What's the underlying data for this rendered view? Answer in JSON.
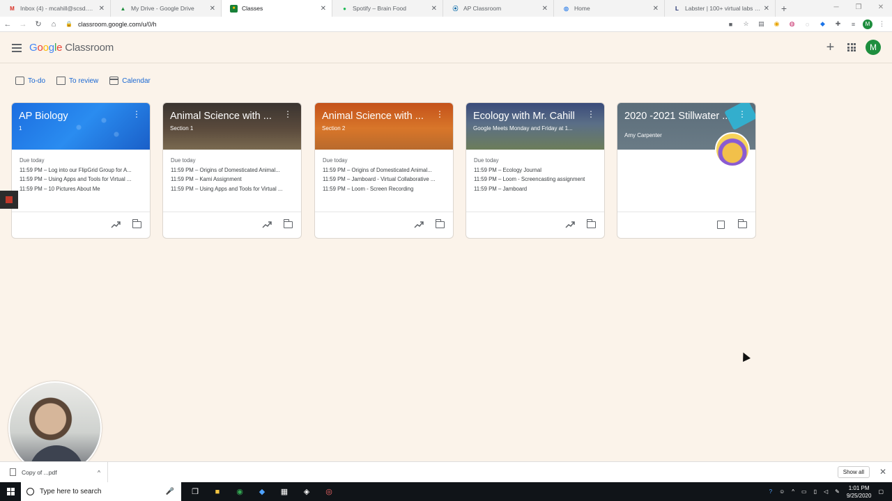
{
  "browser": {
    "tabs": [
      {
        "title": "Inbox (4) - mcahill@scsd.org - St",
        "favicon": "gmail-icon",
        "fav_glyph": "M",
        "fav_color": "#d93025"
      },
      {
        "title": "My Drive - Google Drive",
        "favicon": "drive-icon",
        "fav_glyph": "▲",
        "fav_color": "#1e8e3e"
      },
      {
        "title": "Classes",
        "favicon": "classroom-icon",
        "fav_glyph": "■",
        "fav_color": "#188038"
      },
      {
        "title": "Spotify – Brain Food",
        "favicon": "spotify-icon",
        "fav_glyph": "●",
        "fav_color": "#1db954"
      },
      {
        "title": "AP Classroom",
        "favicon": "ap-icon",
        "fav_glyph": "⦿",
        "fav_color": "#0066a6"
      },
      {
        "title": "Home",
        "favicon": "globe-icon",
        "fav_glyph": "◎",
        "fav_color": "#1a73e8"
      },
      {
        "title": "Labster | 100+ virtual labs for uni",
        "favicon": "labster-icon",
        "fav_glyph": "L",
        "fav_color": "#1b2a6b"
      }
    ],
    "new_tab": "+",
    "url": "classroom.google.com/u/0/h"
  },
  "app": {
    "brand_google": "Google",
    "brand_classroom": "Classroom",
    "avatar_letter": "M",
    "accent": "#1967d2"
  },
  "subnav": {
    "todo": "To-do",
    "review": "To review",
    "calendar": "Calendar"
  },
  "cards": [
    {
      "name": "AP Biology",
      "section": "1",
      "due_label": "Due today",
      "items": [
        "11:59 PM – Log into our FlipGrid Group for A...",
        "11:59 PM – Using Apps and Tools for Virtual ...",
        "11:59 PM – 10 Pictures About Me"
      ]
    },
    {
      "name": "Animal Science with ...",
      "section": "Section 1",
      "due_label": "Due today",
      "items": [
        "11:59 PM – Origins of Domesticated Animal...",
        "11:59 PM – Kami Assignment",
        "11:59 PM – Using Apps and Tools for Virtual ..."
      ]
    },
    {
      "name": "Animal Science with ...",
      "section": "Section 2",
      "due_label": "Due today",
      "items": [
        "11:59 PM – Origins of Domesticated Animal...",
        "11:59 PM – Jamboard - Virtual Collaborative ...",
        "11:59 PM – Loom - Screen Recording"
      ]
    },
    {
      "name": "Ecology with Mr. Cahill",
      "section": "Google Meets Monday and Friday at 1...",
      "due_label": "Due today",
      "items": [
        "11:59 PM – Ecology Journal",
        "11:59 PM – Loom - Screencasting assignment",
        "11:59 PM – Jamboard"
      ]
    },
    {
      "name": "2020 -2021 Stillwater ...",
      "section": "Amy Carpenter",
      "due_label": "",
      "items": []
    }
  ],
  "downloads": {
    "file": "Copy of ...pdf",
    "show_all": "Show all"
  },
  "taskbar": {
    "search_placeholder": "Type here to search",
    "time": "1:01 PM",
    "date": "9/25/2020"
  }
}
